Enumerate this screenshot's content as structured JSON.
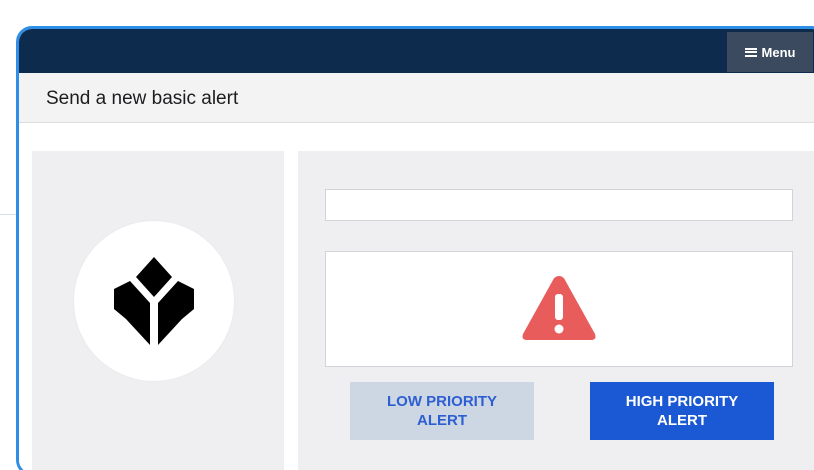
{
  "header": {
    "menu_label": "Menu",
    "menu_icon": "hamburger-icon"
  },
  "page": {
    "title": "Send a new basic alert"
  },
  "logo": {
    "icon": "tulip-logo-icon"
  },
  "alert": {
    "input_value": "",
    "warning_icon": "warning-triangle-icon",
    "warning_color": "#e85c5c"
  },
  "buttons": {
    "low_priority_label": "LOW PRIORITY ALERT",
    "high_priority_label": "HIGH PRIORITY ALERT"
  },
  "colors": {
    "topbar": "#0d2b4c",
    "frame_border": "#2f8ee5",
    "high_button": "#1b58d4",
    "low_button": "#cdd6e3"
  }
}
